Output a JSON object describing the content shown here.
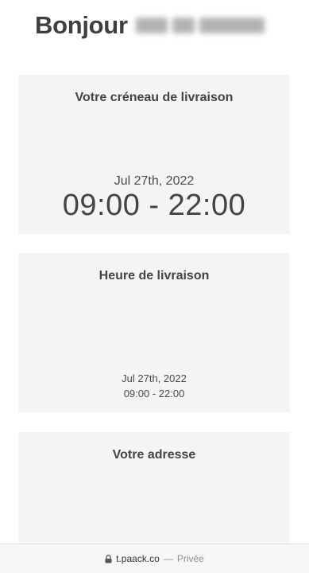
{
  "greeting": {
    "hello": "Bonjour"
  },
  "delivery_window": {
    "title": "Votre créneau de livraison",
    "date": "Jul 27th, 2022",
    "time": "09:00 - 22:00"
  },
  "delivery_time": {
    "title": "Heure de livraison",
    "date": "Jul 27th, 2022",
    "time": "09:00 - 22:00"
  },
  "address": {
    "title": "Votre adresse"
  },
  "browser": {
    "domain": "t.paack.co",
    "separator": "—",
    "privacy": "Privée",
    "lock_icon": "lock-icon"
  },
  "colors": {
    "card_bg": "#f4f4f4",
    "text": "#444444",
    "url_bar_bg": "#f7f7f7"
  }
}
